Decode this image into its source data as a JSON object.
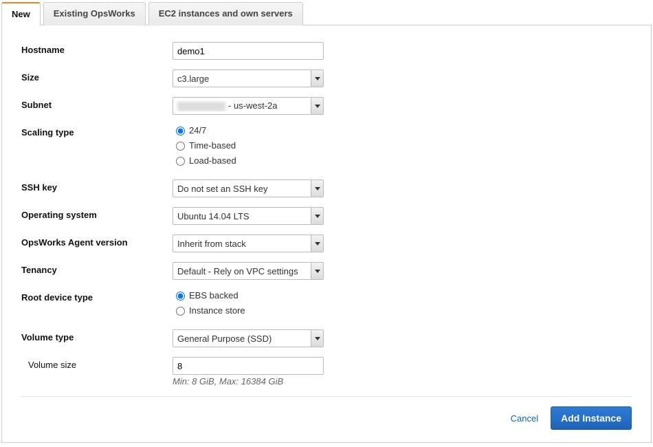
{
  "tabs": {
    "new": "New",
    "existing": "Existing OpsWorks",
    "ec2": "EC2 instances and own servers"
  },
  "form": {
    "hostname": {
      "label": "Hostname",
      "value": "demo1"
    },
    "size": {
      "label": "Size",
      "value": "c3.large"
    },
    "subnet": {
      "label": "Subnet",
      "suffix": "- us-west-2a"
    },
    "scaling": {
      "label": "Scaling type",
      "options": {
        "a": "24/7",
        "b": "Time-based",
        "c": "Load-based"
      }
    },
    "sshkey": {
      "label": "SSH key",
      "value": "Do not set an SSH key"
    },
    "os": {
      "label": "Operating system",
      "value": "Ubuntu 14.04 LTS"
    },
    "agent": {
      "label": "OpsWorks Agent version",
      "value": "Inherit from stack"
    },
    "tenancy": {
      "label": "Tenancy",
      "value": "Default - Rely on VPC settings"
    },
    "rootdev": {
      "label": "Root device type",
      "options": {
        "a": "EBS backed",
        "b": "Instance store"
      }
    },
    "voltype": {
      "label": "Volume type",
      "value": "General Purpose (SSD)"
    },
    "volsize": {
      "label": "Volume size",
      "value": "8",
      "hint": "Min: 8 GiB, Max: 16384 GiB"
    }
  },
  "actions": {
    "cancel": "Cancel",
    "submit": "Add Instance"
  }
}
